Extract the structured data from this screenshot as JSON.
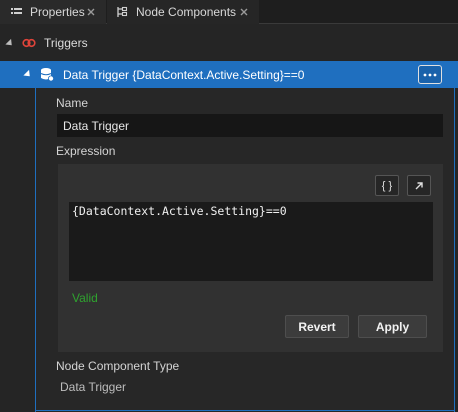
{
  "tabs": [
    {
      "label": "Properties",
      "icon": "properties-list-icon",
      "close": "×"
    },
    {
      "label": "Node Components",
      "icon": "node-components-icon",
      "close": "×"
    }
  ],
  "triggers": {
    "label": "Triggers",
    "icon": "trigger-link-icon",
    "accent": "#e0443a"
  },
  "data_trigger": {
    "label": "Data Trigger {DataContext.Active.Setting}==0",
    "icon": "database-icon",
    "more_button_icon": "more-options-icon",
    "selection_color": "#1f6fbf"
  },
  "fields": {
    "name_label": "Name",
    "name_value": "Data Trigger",
    "expression_label": "Expression",
    "expression_value": "{DataContext.Active.Setting}==0",
    "braces_button": "{ }",
    "open_editor_icon": "arrow-up-right-icon",
    "valid_text": "Valid",
    "valid_color": "#2fa32f",
    "revert_label": "Revert",
    "apply_label": "Apply",
    "type_label": "Node Component Type",
    "type_value": "Data Trigger"
  }
}
